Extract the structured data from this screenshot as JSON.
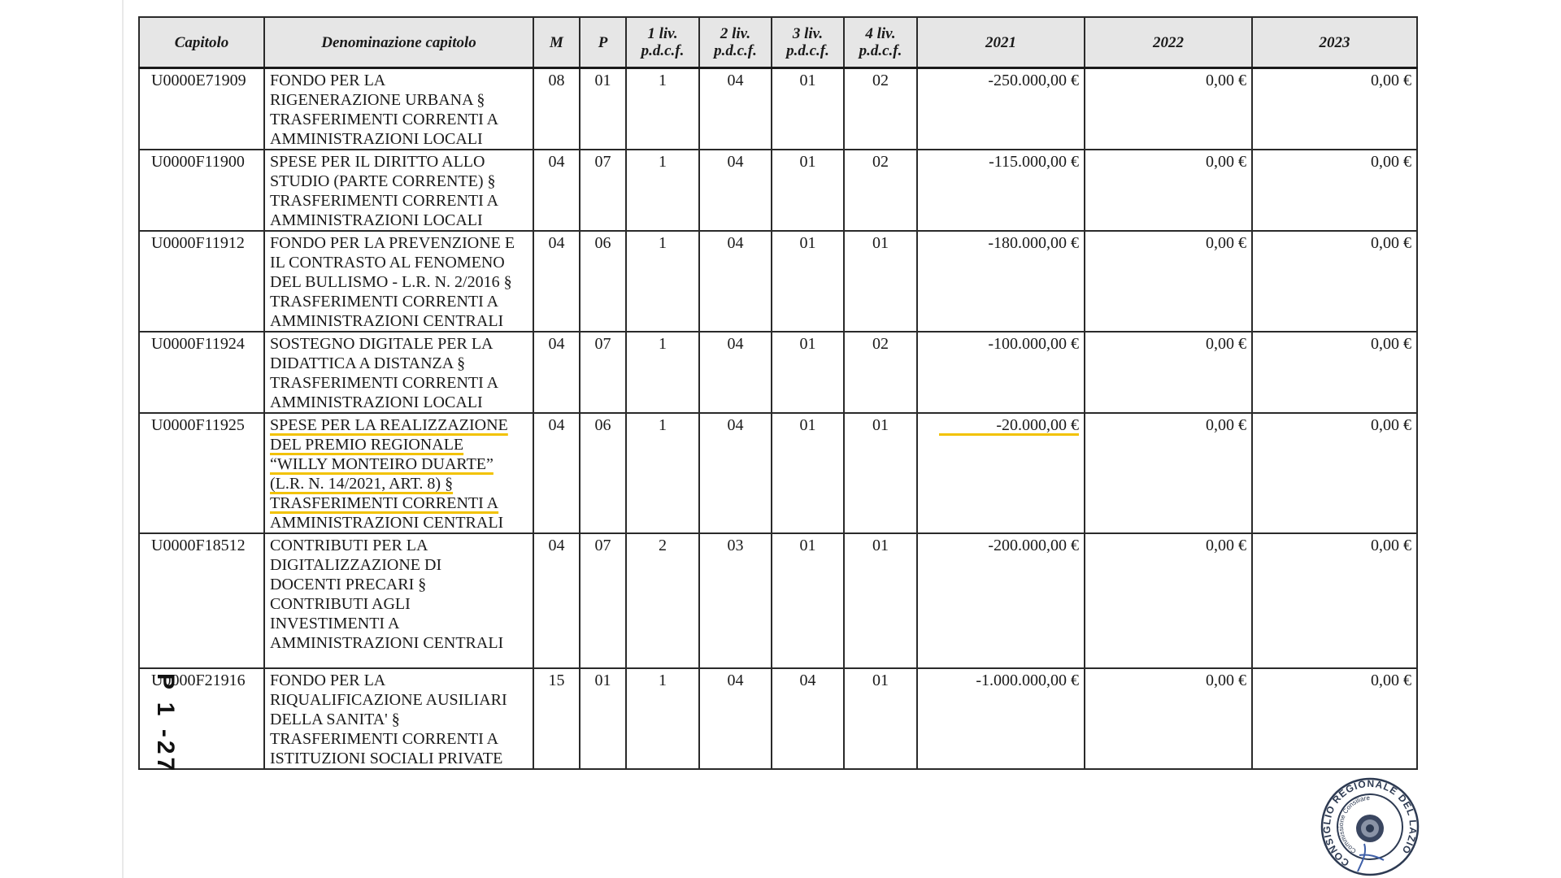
{
  "headers": {
    "capitolo": "Capitolo",
    "denominazione": "Denominazione capitolo",
    "m": "M",
    "p": "P",
    "liv1_a": "1 liv.",
    "liv1_b": "p.d.c.f.",
    "liv2_a": "2 liv.",
    "liv2_b": "p.d.c.f.",
    "liv3_a": "3 liv.",
    "liv3_b": "p.d.c.f.",
    "liv4_a": "4 liv.",
    "liv4_b": "p.d.c.f.",
    "y2021": "2021",
    "y2022": "2022",
    "y2023": "2023"
  },
  "rows": [
    {
      "code": "U0000E71909",
      "lines": [
        "FONDO PER LA",
        "RIGENERAZIONE URBANA §",
        "TRASFERIMENTI CORRENTI A",
        "AMMINISTRAZIONI LOCALI"
      ],
      "m": "08",
      "p": "01",
      "l1": "1",
      "l2": "04",
      "l3": "01",
      "l4": "02",
      "y2021": "-250.000,00 €",
      "y2022": "0,00 €",
      "y2023": "0,00 €"
    },
    {
      "code": "U0000F11900",
      "lines": [
        "SPESE PER IL DIRITTO ALLO",
        "STUDIO (PARTE CORRENTE) §",
        "TRASFERIMENTI CORRENTI A",
        "AMMINISTRAZIONI LOCALI"
      ],
      "m": "04",
      "p": "07",
      "l1": "1",
      "l2": "04",
      "l3": "01",
      "l4": "02",
      "y2021": "-115.000,00 €",
      "y2022": "0,00 €",
      "y2023": "0,00 €"
    },
    {
      "code": "U0000F11912",
      "lines": [
        "FONDO PER LA PREVENZIONE E",
        "IL CONTRASTO AL FENOMENO",
        "DEL BULLISMO - L.R. N. 2/2016 §",
        "TRASFERIMENTI CORRENTI A",
        "AMMINISTRAZIONI CENTRALI"
      ],
      "m": "04",
      "p": "06",
      "l1": "1",
      "l2": "04",
      "l3": "01",
      "l4": "01",
      "y2021": "-180.000,00 €",
      "y2022": "0,00 €",
      "y2023": "0,00 €"
    },
    {
      "code": "U0000F11924",
      "lines": [
        "SOSTEGNO DIGITALE PER LA",
        "DIDATTICA A DISTANZA §",
        "TRASFERIMENTI CORRENTI A",
        "AMMINISTRAZIONI LOCALI"
      ],
      "m": "04",
      "p": "07",
      "l1": "1",
      "l2": "04",
      "l3": "01",
      "l4": "02",
      "y2021": "-100.000,00 €",
      "y2022": "0,00 €",
      "y2023": "0,00 €"
    },
    {
      "code": "U0000F11925",
      "lines": [
        "SPESE PER LA REALIZZAZIONE",
        "DEL PREMIO REGIONALE",
        "“WILLY MONTEIRO DUARTE”",
        "(L.R. N. 14/2021, ART. 8) §",
        "TRASFERIMENTI CORRENTI A",
        "AMMINISTRAZIONI CENTRALI"
      ],
      "m": "04",
      "p": "06",
      "l1": "1",
      "l2": "04",
      "l3": "01",
      "l4": "01",
      "y2021": "-20.000,00 €",
      "y2022": "0,00 €",
      "y2023": "0,00 €"
    },
    {
      "code": "U0000F18512",
      "lines": [
        "CONTRIBUTI PER LA",
        "DIGITALIZZAZIONE DI",
        "DOCENTI PRECARI §",
        "CONTRIBUTI AGLI",
        "INVESTIMENTI A",
        "AMMINISTRAZIONI CENTRALI"
      ],
      "m": "04",
      "p": "07",
      "l1": "2",
      "l2": "03",
      "l3": "01",
      "l4": "01",
      "y2021": "-200.000,00 €",
      "y2022": "0,00 €",
      "y2023": "0,00 €"
    },
    {
      "code": "U0000F21916",
      "lines": [
        "FONDO PER LA",
        "RIQUALIFICAZIONE AUSILIARI",
        "DELLA SANITA' §",
        "TRASFERIMENTI CORRENTI A",
        "ISTITUZIONI SOCIALI PRIVATE"
      ],
      "m": "15",
      "p": "01",
      "l1": "1",
      "l2": "04",
      "l3": "04",
      "l4": "01",
      "y2021": "-1.000.000,00 €",
      "y2022": "0,00 €",
      "y2023": "0,00 €"
    }
  ],
  "page_number": "P 1 -27",
  "stamp": {
    "text": "CONSIGLIO REGIONALE DEL LAZIO",
    "inner_text": "Commissione Consiliare"
  },
  "colors": {
    "highlight": "#f2c200",
    "header_bg": "#e6e6e6",
    "stamp": "#2d3a52"
  }
}
